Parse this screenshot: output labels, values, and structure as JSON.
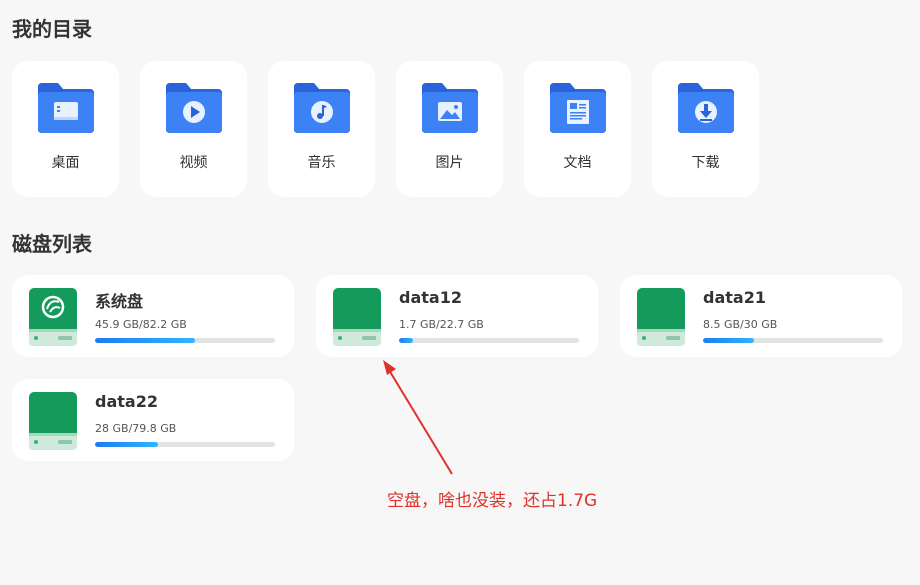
{
  "directories": {
    "title": "我的目录",
    "items": [
      {
        "label": "桌面",
        "icon": "desktop-folder-icon"
      },
      {
        "label": "视频",
        "icon": "video-folder-icon"
      },
      {
        "label": "音乐",
        "icon": "music-folder-icon"
      },
      {
        "label": "图片",
        "icon": "pictures-folder-icon"
      },
      {
        "label": "文档",
        "icon": "documents-folder-icon"
      },
      {
        "label": "下载",
        "icon": "downloads-folder-icon"
      }
    ]
  },
  "disks": {
    "title": "磁盘列表",
    "items": [
      {
        "name": "系统盘",
        "usage": "45.9 GB/82.2 GB",
        "fraction": 0.558,
        "icon": "system-disk-icon"
      },
      {
        "name": "data12",
        "usage": "1.7 GB/22.7 GB",
        "fraction": 0.075,
        "icon": "hard-drive-icon"
      },
      {
        "name": "data21",
        "usage": "8.5 GB/30 GB",
        "fraction": 0.283,
        "icon": "hard-drive-icon"
      },
      {
        "name": "data22",
        "usage": "28 GB/79.8 GB",
        "fraction": 0.351,
        "icon": "hard-drive-icon"
      }
    ]
  },
  "annotation": {
    "text": "空盘，啥也没装，还占1.7G"
  },
  "colors": {
    "folder_blue": "#3a7bf2",
    "folder_back": "#2b63d9",
    "drive_green": "#149b5c",
    "annotation_red": "#e0312a",
    "progress_blue": "#1f7bf0"
  }
}
